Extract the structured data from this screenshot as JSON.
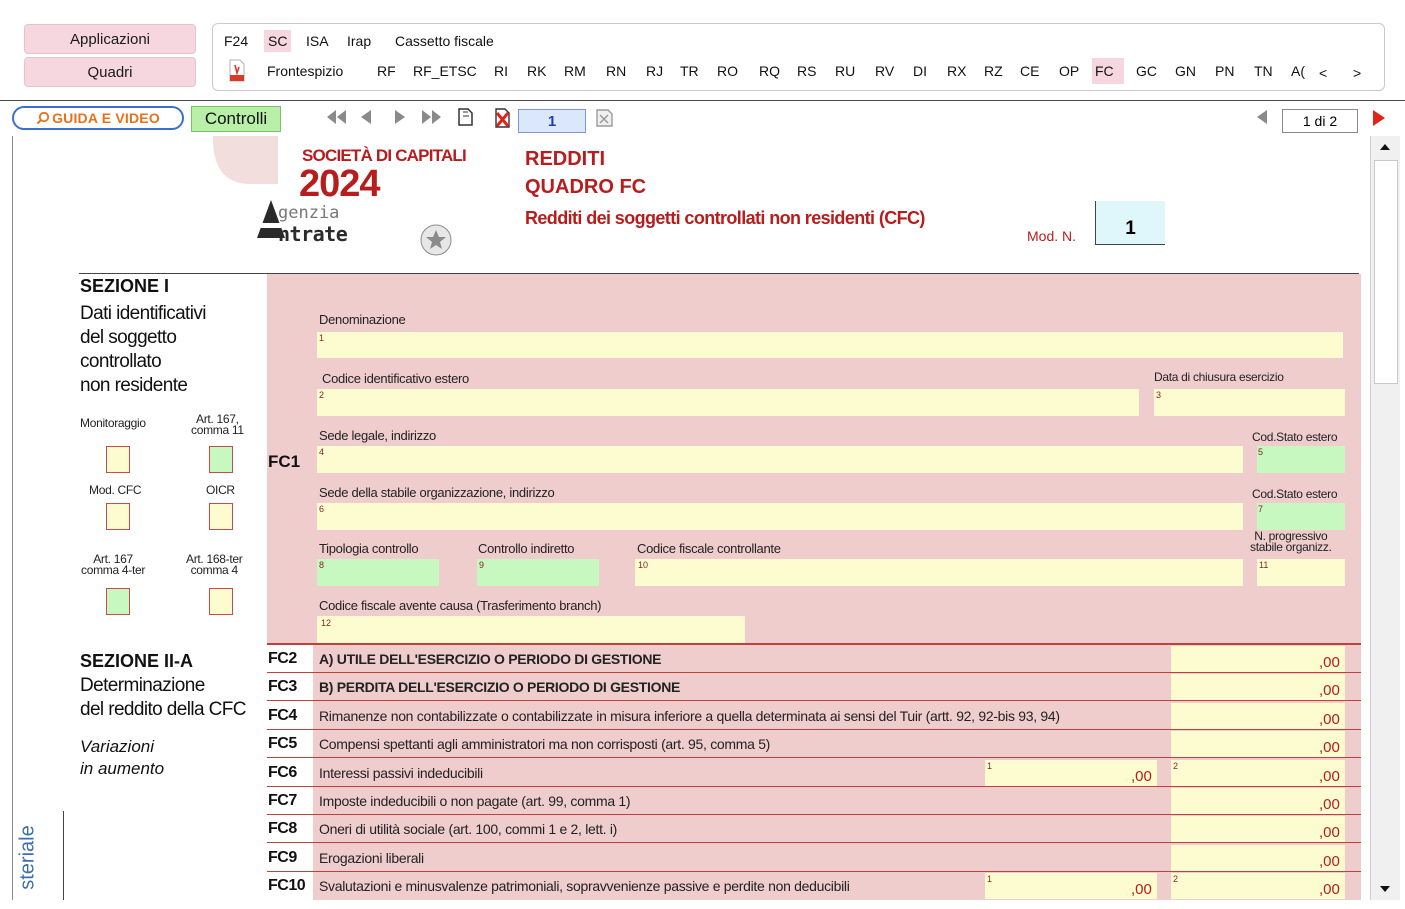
{
  "app_buttons": {
    "applicazioni": "Applicazioni",
    "quadri": "Quadri"
  },
  "top_tabs": [
    "F24",
    "SC",
    "ISA",
    "Irap",
    "Cassetto fiscale"
  ],
  "quadri_tabs": {
    "first": "Frontespizio",
    "items": [
      "RF",
      "RF_ETSC",
      "RI",
      "RK",
      "RM",
      "RN",
      "RJ",
      "TR",
      "RO",
      "RQ",
      "RS",
      "RU",
      "RV",
      "DI",
      "RX",
      "RZ",
      "CE",
      "OP",
      "FC",
      "GC",
      "GN",
      "PN",
      "TN",
      "A("
    ],
    "prev": "<",
    "next": ">"
  },
  "toolbar": {
    "guida": "GUIDA E VIDEO",
    "controlli": "Controlli",
    "page_number": "1",
    "page_count": "1 di 2"
  },
  "colors": {
    "pink_bg": "#efcdcd",
    "yellow_field": "#fdfbd0",
    "green_field": "#c6f8c0",
    "accent_red": "#c0403c",
    "title_red": "#b81d1d"
  },
  "header": {
    "societa": "SOCIETÀ DI CAPITALI",
    "year": "2024",
    "agency_1": "genzia",
    "agency_2": "ntrate",
    "redditi": "REDDITI",
    "quadro": "QUADRO FC",
    "subtitle": "Redditi dei soggetti controllati non residenti (CFC)",
    "mod_label": "Mod. N.",
    "mod_value": "1"
  },
  "sezione1": {
    "title": "SEZIONE I",
    "desc_lines": [
      "Dati identificativi",
      "del soggetto",
      "controllato",
      "non residente"
    ],
    "checkboxes": {
      "monitoraggio": "Monitoraggio",
      "art167_11_a": "Art. 167,",
      "art167_11_b": "comma 11",
      "mod_cfc": "Mod. CFC",
      "oicr": "OICR",
      "art167_4ter_a": "Art. 167",
      "art167_4ter_b": "comma 4-ter",
      "art168ter_a": "Art. 168-ter",
      "art168ter_b": "comma 4"
    },
    "row_code": "FC1",
    "fields": {
      "denominazione": "Denominazione",
      "codice_estero": "Codice identificativo estero",
      "data_chiusura": "Data di chiusura esercizio",
      "sede_legale": "Sede legale, indirizzo",
      "cod_stato_1": "Cod.Stato estero",
      "sede_stabile": "Sede della stabile organizzazione, indirizzo",
      "cod_stato_2": "Cod.Stato estero",
      "tipologia": "Tipologia controllo",
      "controllo_indiretto": "Controllo indiretto",
      "cf_controllante": "Codice fiscale controllante",
      "progressivo_a": "N. progressivo",
      "progressivo_b": "stabile organizz.",
      "cf_avente_causa": "Codice fiscale avente causa (Trasferimento branch)"
    },
    "field_numbers": [
      "1",
      "2",
      "3",
      "4",
      "5",
      "6",
      "7",
      "8",
      "9",
      "10",
      "11",
      "12"
    ]
  },
  "sezione2": {
    "title": "SEZIONE II-A",
    "desc_lines": [
      "Determinazione",
      "del reddito della CFC"
    ],
    "variazioni": [
      "Variazioni",
      "in aumento"
    ],
    "rows": [
      {
        "code": "FC2",
        "label": "A) UTILE DELL'ESERCIZIO O PERIODO DI GESTIONE",
        "value": ",00"
      },
      {
        "code": "FC3",
        "label": "B) PERDITA DELL'ESERCIZIO O PERIODO DI GESTIONE",
        "value": ",00"
      },
      {
        "code": "FC4",
        "label": "Rimanenze non contabilizzate o contabilizzate in misura inferiore a quella determinata ai sensi del Tuir (artt. 92, 92-bis 93, 94)",
        "value": ",00"
      },
      {
        "code": "FC5",
        "label": "Compensi spettanti agli amministratori ma non corrisposti (art. 95, comma 5)",
        "value": ",00"
      },
      {
        "code": "FC6",
        "label": "Interessi passivi indeducibili",
        "value1": ",00",
        "value": ",00"
      },
      {
        "code": "FC7",
        "label": "Imposte indeducibili o non pagate (art. 99, comma 1)",
        "value": ",00"
      },
      {
        "code": "FC8",
        "label": "Oneri di utilità sociale (art. 100, commi 1 e 2, lett. i)",
        "value": ",00"
      },
      {
        "code": "FC9",
        "label": "Erogazioni liberali",
        "value": ",00"
      },
      {
        "code": "FC10",
        "label": "Svalutazioni e minusvalenze patrimoniali, sopravvenienze passive e perdite non deducibili",
        "value1": ",00",
        "value": ",00"
      }
    ],
    "small_1": "1",
    "small_2": "2"
  },
  "side_text": "steriale"
}
